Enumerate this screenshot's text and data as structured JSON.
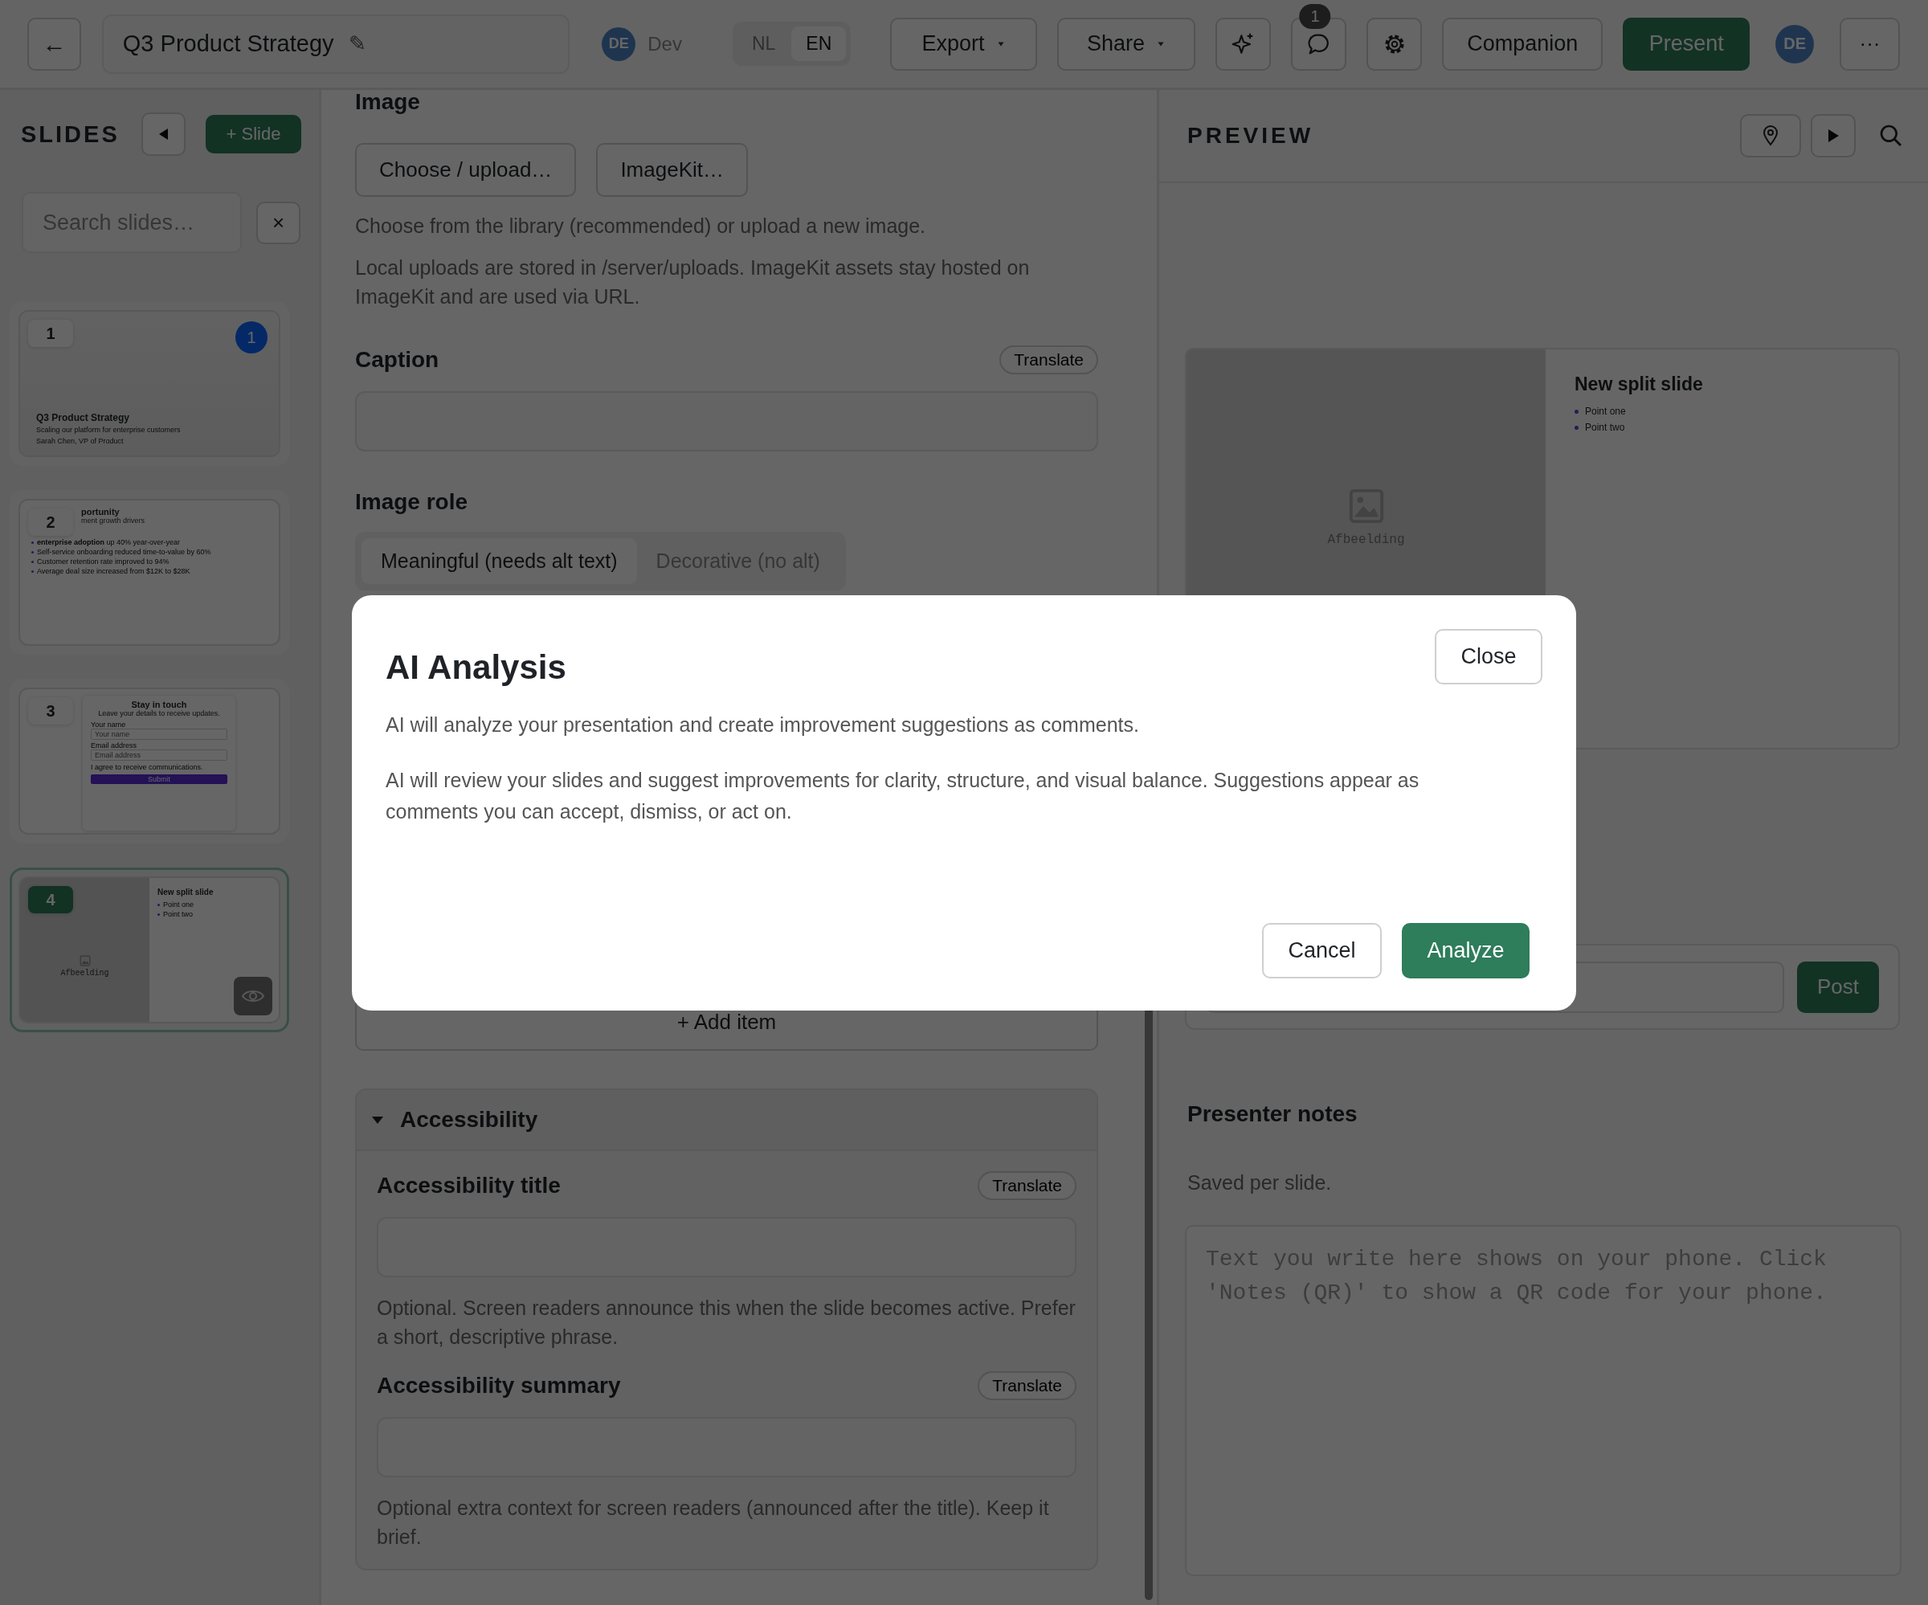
{
  "topbar": {
    "back": "←",
    "title": "Q3 Product Strategy",
    "edit": "✎",
    "user": {
      "initials": "DE",
      "name": "Dev"
    },
    "languages": [
      {
        "label": "NL",
        "selected": false
      },
      {
        "label": "EN",
        "selected": true
      }
    ],
    "export": "Export",
    "share": "Share",
    "comment_count": "1",
    "companion": "Companion",
    "present": "Present",
    "avatar": "DE",
    "more": "···"
  },
  "sidebar": {
    "title": "SLIDES",
    "add": "+ Slide",
    "search_placeholder": "Search slides…",
    "clear": "×",
    "slides": [
      {
        "number": "1",
        "kind": "title",
        "selected": false,
        "comments": "1",
        "title": "Q3 Product Strategy",
        "subtitle": "Scaling our platform for enterprise customers",
        "author": "Sarah Chen, VP of Product"
      },
      {
        "number": "2",
        "kind": "bullets",
        "selected": false,
        "title": "portunity",
        "subtitle": "ment growth drivers",
        "bullets": [
          "**enterprise adoption** up 40% year-over-year",
          "Self-service onboarding reduced time-to-value by 60%",
          "Customer retention rate improved to 94%",
          "Average deal size increased from $12K to $28K"
        ]
      },
      {
        "number": "3",
        "kind": "form",
        "selected": false,
        "title": "Stay in touch",
        "subtitle": "Leave your details to receive updates.",
        "fields": [
          {
            "label": "Your name",
            "placeholder": "Your name"
          },
          {
            "label": "Email address",
            "placeholder": "Email address"
          }
        ],
        "consent": "I agree to receive communications.",
        "submit": "Submit"
      },
      {
        "number": "4",
        "kind": "split",
        "selected": true,
        "title": "New split slide",
        "bullets": [
          "Point one",
          "Point two"
        ],
        "image_label": "Afbeelding"
      }
    ]
  },
  "editor": {
    "image": {
      "heading": "Image",
      "buttons": [
        "Choose / upload…",
        "ImageKit…"
      ],
      "help": [
        "Choose from the library (recommended) or upload a new image.",
        "Local uploads are stored in /server/uploads. ImageKit assets stay hosted on ImageKit and are used via URL."
      ]
    },
    "caption": {
      "label": "Caption",
      "translate": "Translate"
    },
    "image_role": {
      "label": "Image role",
      "options": [
        {
          "label": "Meaningful (needs alt text)",
          "selected": true
        },
        {
          "label": "Decorative (no alt)",
          "selected": false
        }
      ]
    },
    "add_item": "+ Add item",
    "accessibility": {
      "title": "Accessibility",
      "expanded": true,
      "fields": [
        {
          "label": "Accessibility title",
          "translate": "Translate",
          "help": "Optional. Screen readers announce this when the slide becomes active. Prefer a short, descriptive phrase."
        },
        {
          "label": "Accessibility summary",
          "translate": "Translate",
          "help": "Optional extra context for screen readers (announced after the title). Keep it brief."
        }
      ]
    }
  },
  "preview": {
    "title": "PREVIEW",
    "slide": {
      "image_label": "Afbeelding",
      "title": "New split slide",
      "bullets": [
        "Point one",
        "Point two"
      ]
    },
    "post": "Post",
    "notes_title": "Presenter notes",
    "notes_hint": "Saved per slide.",
    "notes_placeholder": "Text you write here shows on your phone. Click 'Notes (QR)' to show a QR code for your phone."
  },
  "modal": {
    "title": "AI Analysis",
    "close": "Close",
    "intro": "AI will analyze your presentation and create improvement suggestions as comments.",
    "body": "AI will review your slides and suggest improvements for clarity, structure, and visual balance. Suggestions appear as comments you can accept, dismiss, or act on.",
    "cancel": "Cancel",
    "confirm": "Analyze"
  }
}
